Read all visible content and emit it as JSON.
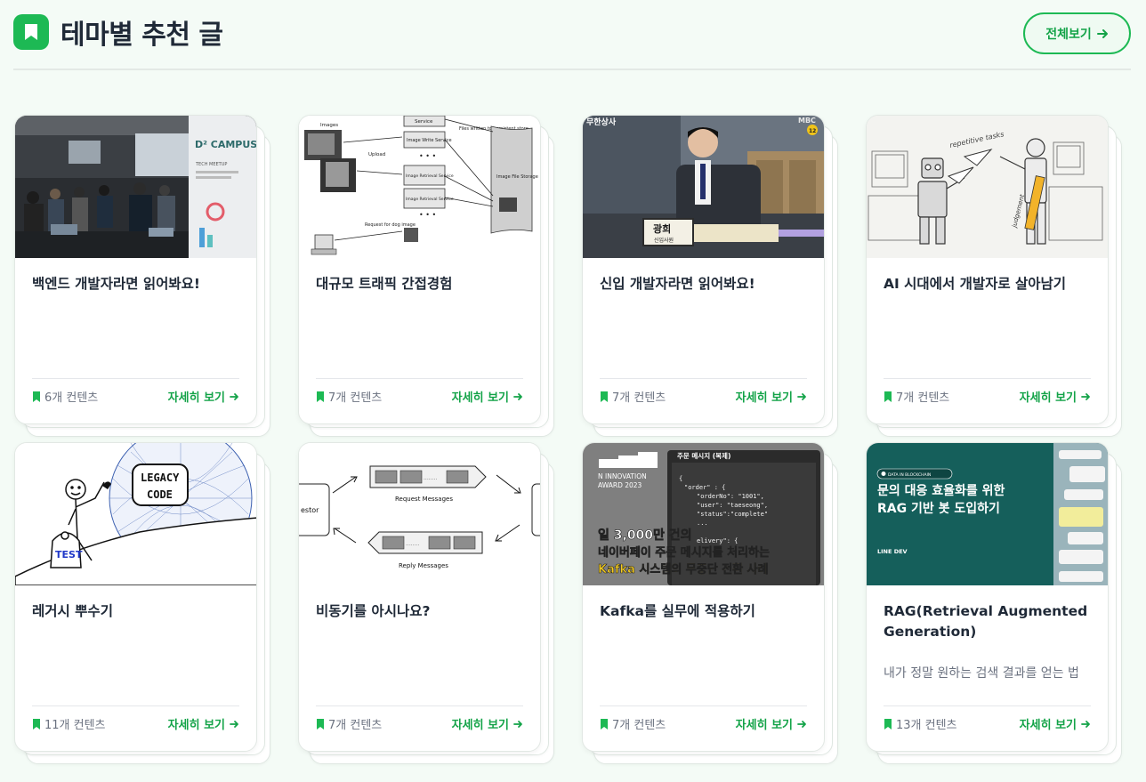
{
  "header": {
    "title": "테마별 추천 글",
    "view_all": "전체보기",
    "title_icon": "bookmark-icon"
  },
  "colors": {
    "accent": "#1db954",
    "accent_text": "#13a348",
    "background": "#f4fbf6"
  },
  "cards": [
    {
      "title": "백엔드 개발자라면 읽어봐요!",
      "description": "",
      "count": "6개 컨텐츠",
      "link": "자세히 보기",
      "thumb_text": {
        "brand": "D² CAMPUS",
        "sub": "TECH MEETUP"
      }
    },
    {
      "title": "대규모 트래픽 간접경험",
      "description": "",
      "count": "7개 컨텐츠",
      "link": "자세히 보기",
      "thumb_text": {
        "images": "Images",
        "upload": "Upload",
        "service": "Service",
        "write": "Image Write Service",
        "retrieval1": "Image Retrieval Service",
        "retrieval2": "Image Retrieval Service",
        "files": "Files written to persistent store",
        "storage": "Image File Storage",
        "request": "Request for dog image"
      }
    },
    {
      "title": "신입 개발자라면 읽어봐요!",
      "description": "",
      "count": "7개 컨텐츠",
      "link": "자세히 보기",
      "thumb_text": {
        "caption": "무한상사",
        "logo": "MBC",
        "rating": "12",
        "name": "광희",
        "role": "신입사원"
      }
    },
    {
      "title": "AI 시대에서 개발자로 살아남기",
      "description": "",
      "count": "7개 컨텐츠",
      "link": "자세히 보기",
      "thumb_text": {
        "tasks": "repetitive tasks",
        "judgement": "judgement"
      }
    },
    {
      "title": "레거시 뿌수기",
      "description": "",
      "count": "11개 컨텐츠",
      "link": "자세히 보기",
      "thumb_text": {
        "legacy1": "LEGACY",
        "legacy2": "CODE",
        "test": "TEST"
      }
    },
    {
      "title": "비동기를 아시나요?",
      "description": "",
      "count": "7개 컨텐츠",
      "link": "자세히 보기",
      "thumb_text": {
        "request": "Request Messages",
        "reply": "Reply Messages",
        "requestor": "estor"
      }
    },
    {
      "title": "Kafka를 실무에 적용하기",
      "description": "",
      "count": "7개 컨텐츠",
      "link": "자세히 보기",
      "thumb_text": {
        "award1": "N INNOVATION",
        "award2": "AWARD  2023",
        "panel": "주문 메시지 (복제)",
        "line1": "일 3,000만 건의",
        "line2": "네이버페이 주문 메시지를 처리하는",
        "line3": "Kafka 시스템의 무중단 전환 사례",
        "code1": "{",
        "code2": "\"order\" : {",
        "code3": "\"orderNo\": \"1001\",",
        "code4": "\"user\": \"taeseong\",",
        "code5": "\"status\":\"complete\"",
        "code6": "...",
        "code7": "elivery\": {"
      }
    },
    {
      "title": "RAG(Retrieval Augmented Generation)",
      "description": "내가 정말 원하는 검색 결과를 얻는 법",
      "count": "13개 컨텐츠",
      "link": "자세히 보기",
      "thumb_text": {
        "tag": "DATA IN BLOCKCHAIN",
        "h1": "문의 대응 효율화를 위한",
        "h2": "RAG 기반 봇 도입하기",
        "brand": "LINE DEV"
      }
    }
  ]
}
